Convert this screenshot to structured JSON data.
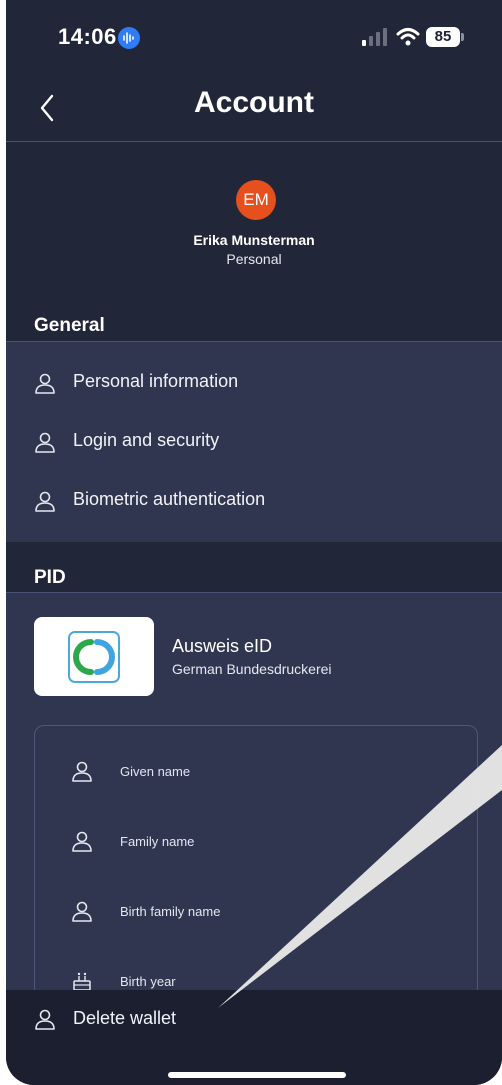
{
  "status_bar": {
    "time": "14:06",
    "battery": "85"
  },
  "header": {
    "title": "Account"
  },
  "profile": {
    "initials": "EM",
    "name": "Erika Munsterman",
    "type": "Personal"
  },
  "general": {
    "title": "General",
    "items": [
      {
        "label": "Personal information",
        "icon": "person-icon"
      },
      {
        "label": "Login and security",
        "icon": "person-icon"
      },
      {
        "label": "Biometric authentication",
        "icon": "person-icon"
      }
    ]
  },
  "pid": {
    "title": "PID",
    "card_name": "Ausweis eID",
    "issuer": "German Bundesdruckerei",
    "attributes": [
      {
        "label": "Given name",
        "icon": "person-icon"
      },
      {
        "label": "Family name",
        "icon": "person-icon"
      },
      {
        "label": "Birth family name",
        "icon": "person-icon"
      },
      {
        "label": "Birth year",
        "icon": "cake-icon"
      }
    ]
  },
  "footer": {
    "delete_label": "Delete wallet"
  },
  "colors": {
    "background": "#222639",
    "panel": "#30364f",
    "avatar": "#e6501c",
    "accent": "#2f7cf6"
  }
}
